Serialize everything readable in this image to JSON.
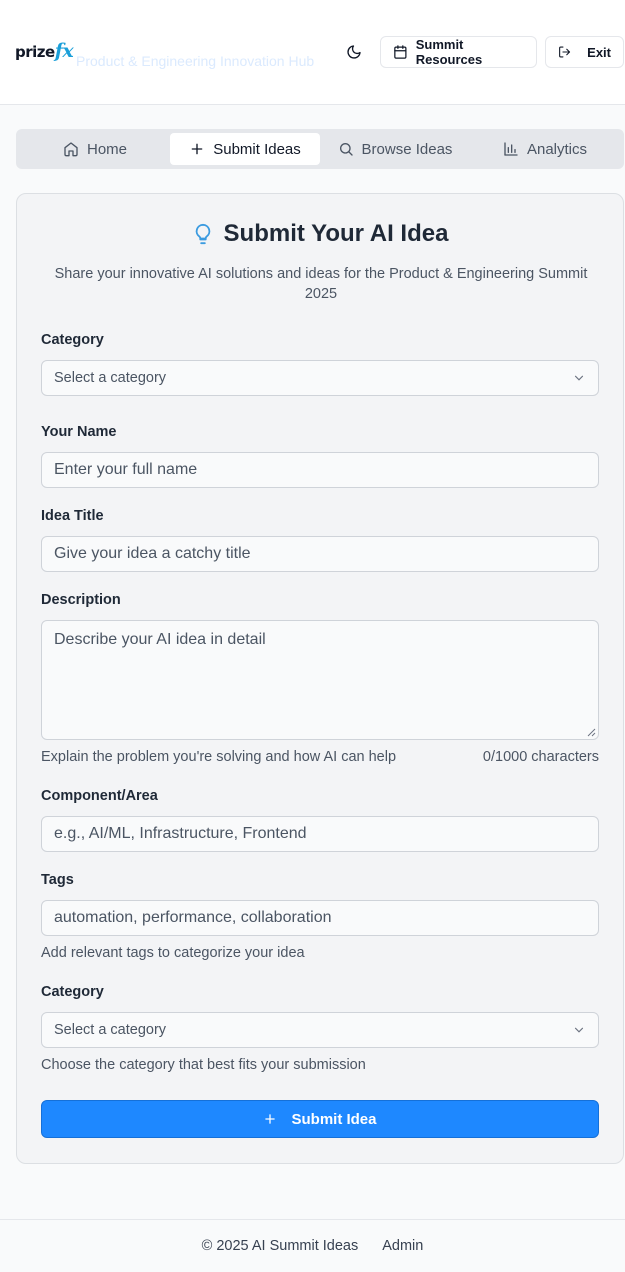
{
  "header": {
    "logo_text": "prize",
    "logo_accent": "fx",
    "hub_title": "Product & Engineering Innovation Hub",
    "resources_label": "Summit Resources",
    "exit_label": "Exit"
  },
  "tabs": [
    {
      "label": "Home",
      "icon": "home-icon"
    },
    {
      "label": "Submit Ideas",
      "icon": "plus-icon",
      "active": true
    },
    {
      "label": "Browse Ideas",
      "icon": "search-icon"
    },
    {
      "label": "Analytics",
      "icon": "bar-chart-icon"
    }
  ],
  "form": {
    "title": "Submit Your AI Idea",
    "subtitle": "Share your innovative AI solutions and ideas for the Product & Engineering Summit 2025",
    "category_label": "Category",
    "category_placeholder": "Select a category",
    "name_label": "Your Name",
    "name_placeholder": "Enter your full name",
    "title_label": "Idea Title",
    "title_placeholder": "Give your idea a catchy title",
    "description_label": "Description",
    "description_placeholder": "Describe your AI idea in detail",
    "description_help": "Explain the problem you're solving and how AI can help",
    "description_counter": "0/1000 characters",
    "component_label": "Component/Area",
    "component_placeholder": "e.g., AI/ML, Infrastructure, Frontend",
    "tags_label": "Tags",
    "tags_placeholder": "automation, performance, collaboration",
    "tags_help": "Add relevant tags to categorize your idea",
    "category2_label": "Category",
    "category2_placeholder": "Select a category",
    "category2_help": "Choose the category that best fits your submission",
    "submit_label": "Submit Idea"
  },
  "footer": {
    "copyright": "© 2025 AI Summit Ideas",
    "admin_link": "Admin"
  },
  "colors": {
    "primary": "#1e88ff",
    "brand_accent": "#1a9fd9",
    "icon_accent": "#3b9be0"
  }
}
